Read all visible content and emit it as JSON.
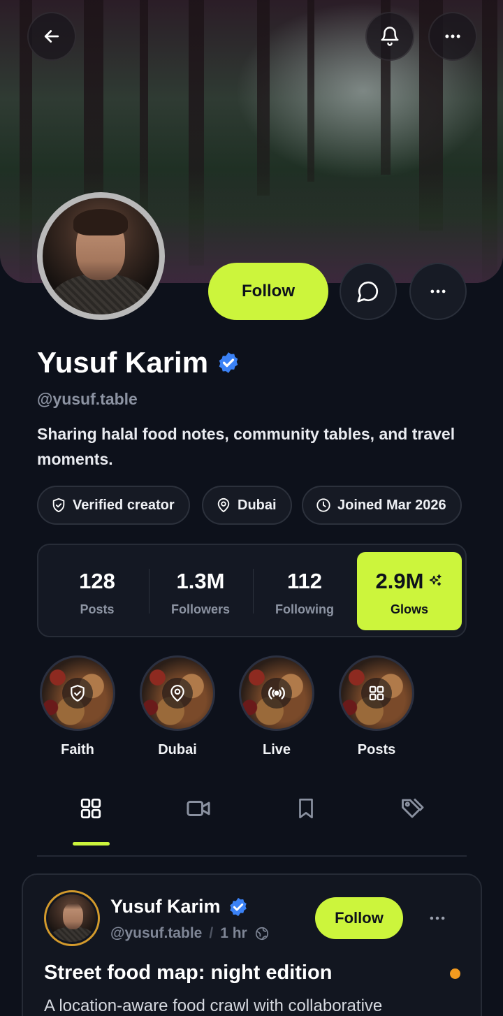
{
  "profile": {
    "name": "Yusuf Karim",
    "handle": "@yusuf.table",
    "bio": "Sharing halal food notes, community tables, and travel moments.",
    "verified": true
  },
  "actions": {
    "follow_label": "Follow"
  },
  "chips": [
    {
      "label": "Verified creator",
      "icon": "shield-check-icon"
    },
    {
      "label": "Dubai",
      "icon": "map-pin-icon"
    },
    {
      "label": "Joined Mar 2026",
      "icon": "clock-icon"
    }
  ],
  "stats": [
    {
      "value": "128",
      "label": "Posts"
    },
    {
      "value": "1.3M",
      "label": "Followers"
    },
    {
      "value": "112",
      "label": "Following"
    },
    {
      "value": "2.9M",
      "label": "Glows",
      "highlighted": true
    }
  ],
  "highlights": [
    {
      "label": "Faith",
      "icon": "shield-icon"
    },
    {
      "label": "Dubai",
      "icon": "map-pin-icon"
    },
    {
      "label": "Live",
      "icon": "broadcast-icon"
    },
    {
      "label": "Posts",
      "icon": "grid-icon"
    }
  ],
  "tabs": [
    {
      "name": "grid",
      "icon": "grid-icon",
      "active": true
    },
    {
      "name": "videos",
      "icon": "video-icon"
    },
    {
      "name": "saved",
      "icon": "bookmark-icon"
    },
    {
      "name": "tagged",
      "icon": "tag-icon"
    }
  ],
  "post": {
    "author": "Yusuf Karim",
    "handle": "@yusuf.table",
    "separator": "/",
    "time": "1 hr",
    "follow_label": "Follow",
    "title": "Street food map: night edition",
    "text": "A location-aware food crawl with collaborative"
  },
  "colors": {
    "accent": "#ccf53c",
    "background": "#0d111b",
    "verified": "#3b82f6",
    "status_dot": "#f39b1f"
  }
}
